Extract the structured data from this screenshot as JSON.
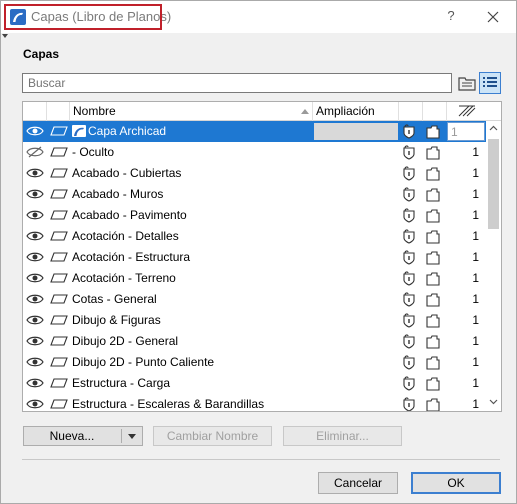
{
  "window": {
    "title": "Capas (Libro de Planos)",
    "help_label": "?"
  },
  "section": {
    "title": "Capas"
  },
  "search": {
    "placeholder": "Buscar"
  },
  "table": {
    "columns": {
      "name": "Nombre",
      "ampliacion": "Ampliación"
    },
    "rows": [
      {
        "name": "Capa Archicad",
        "visible": true,
        "ampliacion": "",
        "number": "1",
        "selected": true,
        "icon": "archicad-icon"
      },
      {
        "name": "- Oculto",
        "visible": false,
        "ampliacion": "",
        "number": "1"
      },
      {
        "name": "Acabado - Cubiertas",
        "visible": true,
        "ampliacion": "",
        "number": "1"
      },
      {
        "name": "Acabado - Muros",
        "visible": true,
        "ampliacion": "",
        "number": "1"
      },
      {
        "name": "Acabado - Pavimento",
        "visible": true,
        "ampliacion": "",
        "number": "1"
      },
      {
        "name": "Acotación - Detalles",
        "visible": true,
        "ampliacion": "",
        "number": "1"
      },
      {
        "name": "Acotación - Estructura",
        "visible": true,
        "ampliacion": "",
        "number": "1"
      },
      {
        "name": "Acotación - Terreno",
        "visible": true,
        "ampliacion": "",
        "number": "1"
      },
      {
        "name": "Cotas - General",
        "visible": true,
        "ampliacion": "",
        "number": "1"
      },
      {
        "name": "Dibujo & Figuras",
        "visible": true,
        "ampliacion": "",
        "number": "1"
      },
      {
        "name": "Dibujo 2D - General",
        "visible": true,
        "ampliacion": "",
        "number": "1"
      },
      {
        "name": "Dibujo 2D - Punto Caliente",
        "visible": true,
        "ampliacion": "",
        "number": "1"
      },
      {
        "name": "Estructura - Carga",
        "visible": true,
        "ampliacion": "",
        "number": "1"
      },
      {
        "name": "Estructura - Escaleras & Barandillas",
        "visible": true,
        "ampliacion": "",
        "number": "1"
      }
    ]
  },
  "buttons": {
    "nueva": "Nueva...",
    "cambiar_nombre": "Cambiar Nombre",
    "eliminar": "Eliminar...",
    "cancelar": "Cancelar",
    "ok": "OK"
  },
  "colors": {
    "accent": "#1e78d2",
    "title_highlight": "#c0202a",
    "archicad_icon": "#2b6cc4"
  }
}
